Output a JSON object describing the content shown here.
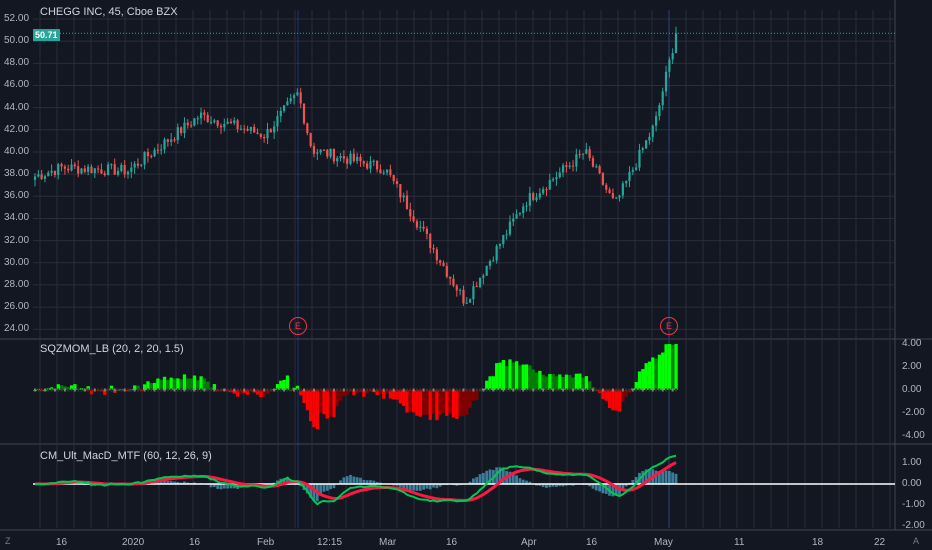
{
  "symbol_title": "CHEGG INC, 45, Cboe BZX",
  "price_badge": "50.71",
  "colors": {
    "up": "#26a69a",
    "down": "#ef5350",
    "grid": "#2a2e39",
    "bg": "#131722",
    "sqz_pos": "#00e600",
    "sqz_neg": "#e60000",
    "macd_fast": "#00c853",
    "macd_slow": "#ff1744",
    "macd_hist": "#4fa8c9"
  },
  "panes": {
    "price": {
      "y_labels": [
        "52.00",
        "50.00",
        "48.00",
        "46.00",
        "44.00",
        "42.00",
        "40.00",
        "38.00",
        "36.00",
        "34.00",
        "32.00",
        "30.00",
        "28.00",
        "26.00",
        "24.00"
      ]
    },
    "sqz": {
      "title": "SQZMOM_LB (20, 2, 20, 1.5)",
      "y_labels": [
        "4.00",
        "2.00",
        "0.00",
        "-2.00",
        "-4.00"
      ]
    },
    "macd": {
      "title": "CM_Ult_MacD_MTF (60, 12, 26, 9)",
      "y_labels": [
        "1.00",
        "0.00",
        "-1.00",
        "-2.00"
      ]
    }
  },
  "earnings_markers": [
    "E",
    "E"
  ],
  "x_labels": [
    "16",
    "2020",
    "16",
    "Feb",
    "12:15",
    "Mar",
    "16",
    "Apr",
    "16",
    "May",
    "11",
    "18",
    "22"
  ],
  "corners": {
    "left": "Z",
    "right": "A"
  },
  "chart_data": {
    "type": "candlestick",
    "title": "CHEGG INC, 45, Cboe BZX",
    "ylim": [
      23.5,
      52.5
    ],
    "key_closes": [
      {
        "x": "Dec 10",
        "y": 37.8
      },
      {
        "x": "16",
        "y": 38.6
      },
      {
        "x": "2020",
        "y": 38.3
      },
      {
        "x": "Jan 16",
        "y": 43.3
      },
      {
        "x": "Feb",
        "y": 41.5
      },
      {
        "x": "Feb 10",
        "y": 45.3
      },
      {
        "x": "Feb 12",
        "y": 40.2
      },
      {
        "x": "Mar",
        "y": 38.5
      },
      {
        "x": "Mar 16",
        "y": 26.5
      },
      {
        "x": "Apr",
        "y": 35.5
      },
      {
        "x": "Apr 16",
        "y": 40.0
      },
      {
        "x": "Apr 22",
        "y": 35.2
      },
      {
        "x": "May",
        "y": 42.5
      },
      {
        "x": "May 5",
        "y": 50.71
      }
    ],
    "last_close": 50.71
  }
}
